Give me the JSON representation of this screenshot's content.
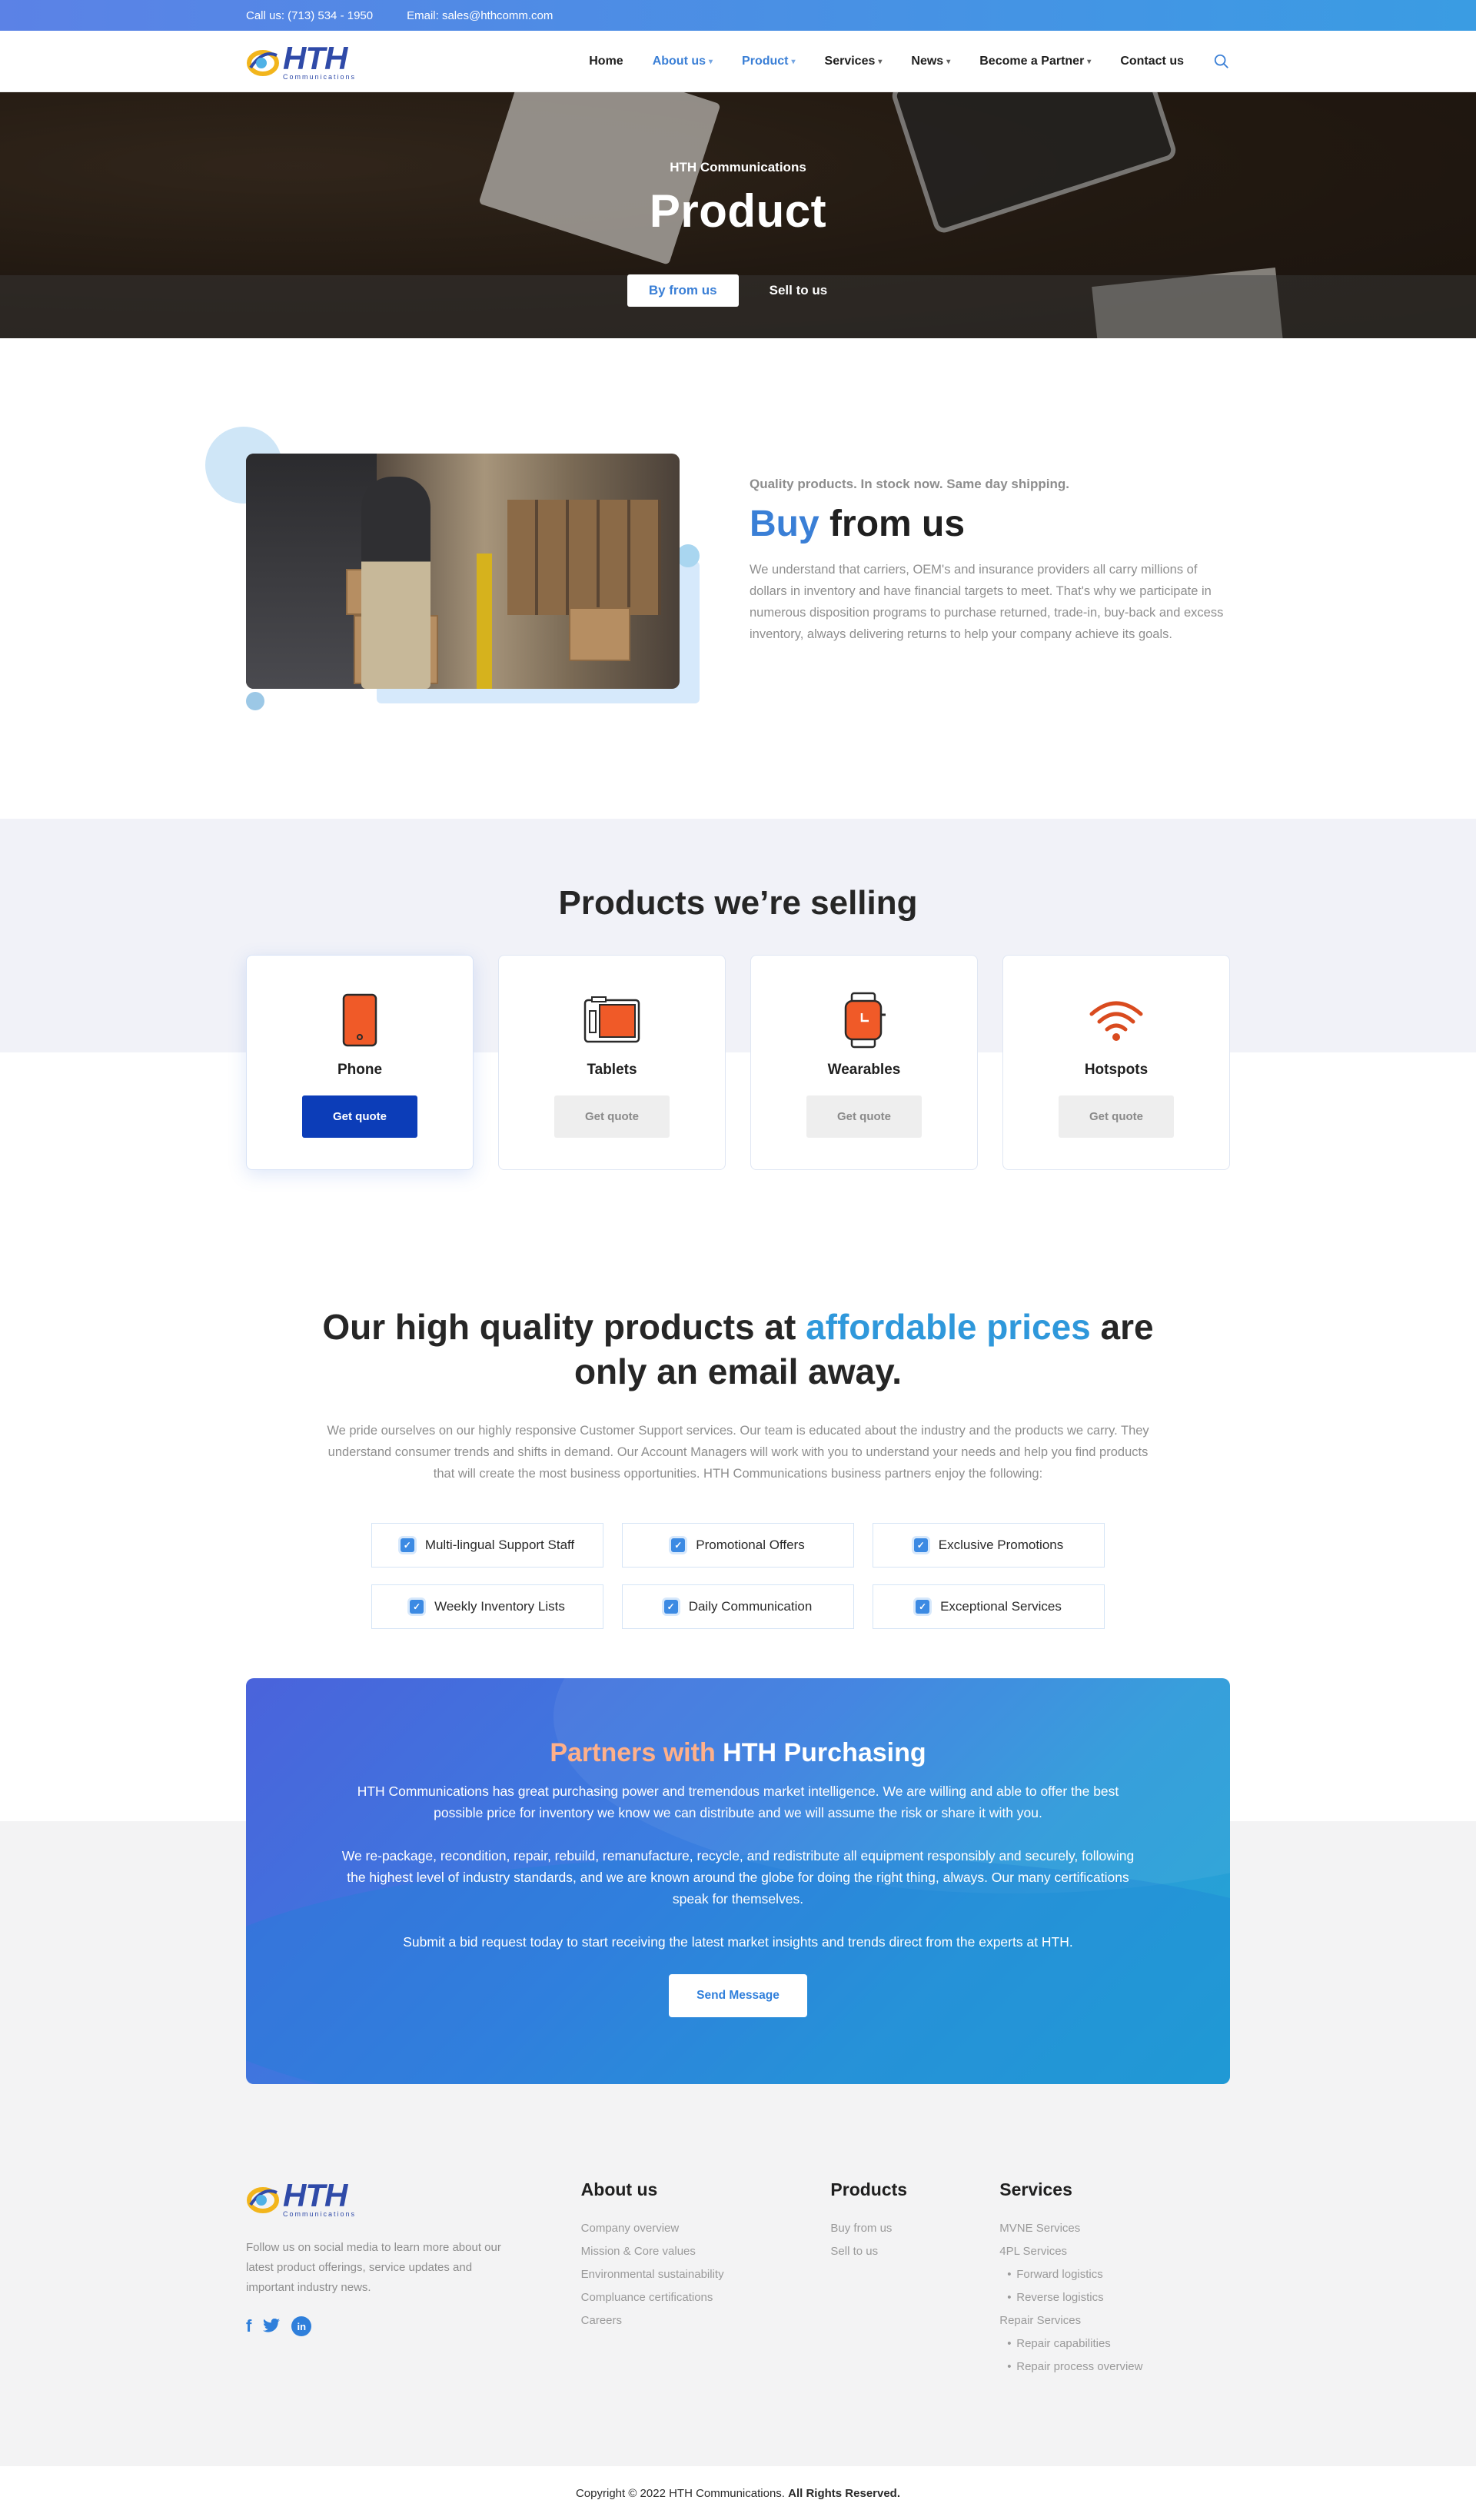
{
  "topbar": {
    "phone": "Call us: (713) 534 - 1950",
    "email": "Email: sales@hthcomm.com"
  },
  "brand": {
    "name": "HTH",
    "sub": "Communications"
  },
  "nav": [
    {
      "label": "Home",
      "active": false,
      "caret": false
    },
    {
      "label": "About us",
      "active": true,
      "caret": true
    },
    {
      "label": "Product",
      "active": true,
      "caret": true
    },
    {
      "label": "Services",
      "active": false,
      "caret": true
    },
    {
      "label": "News",
      "active": false,
      "caret": true
    },
    {
      "label": "Become a Partner",
      "active": false,
      "caret": true
    },
    {
      "label": "Contact us",
      "active": false,
      "caret": false
    }
  ],
  "hero": {
    "eyebrow": "HTH Communications",
    "title": "Product",
    "tab_buy": "By from us",
    "tab_sell": "Sell to us"
  },
  "buy": {
    "tag": "Quality products. In stock now. Same day shipping.",
    "title_hl": "Buy",
    "title_rest": " from us",
    "body": "We understand that carriers, OEM's and insurance providers all carry millions of dollars in inventory and have financial targets to meet. That's why we participate in numerous disposition programs to purchase returned, trade-in, buy-back and excess inventory, always delivering returns to help your company achieve its goals."
  },
  "selling": {
    "title": "Products we’re selling",
    "cards": [
      {
        "name": "Phone",
        "button": "Get quote"
      },
      {
        "name": "Tablets",
        "button": "Get quote"
      },
      {
        "name": "Wearables",
        "button": "Get quote"
      },
      {
        "name": "Hotspots",
        "button": "Get quote"
      }
    ]
  },
  "afford": {
    "title_a": "Our high quality products at ",
    "title_hl": "affordable prices",
    "title_b": " are only an email away.",
    "body": "We pride ourselves on our highly responsive Customer Support services. Our team is educated about the industry and the products we carry. They understand consumer trends and shifts in demand. Our Account Managers will work with you to understand your needs and help you find products that will create the most business opportunities. HTH Communications business partners enjoy the following:",
    "features": [
      "Multi-lingual Support Staff",
      "Promotional Offers",
      "Exclusive Promotions",
      "Weekly Inventory Lists",
      "Daily Communication",
      "Exceptional Services"
    ]
  },
  "partners": {
    "title_hl": "Partners with",
    "title_rest": " HTH Purchasing",
    "p1": "HTH Communications has great purchasing power and tremendous market intelligence. We are willing and able to offer the best possible price for inventory we know we can distribute and we will assume the risk or share it with you.",
    "p2": "We re-package, recondition, repair, rebuild, remanufacture, recycle, and redistribute all equipment responsibly and securely, following the highest level of industry standards, and we are known around the globe for doing the right thing, always. Our many certifications speak for themselves.",
    "p3": "Submit a bid request today to start receiving the latest market insights and trends direct from the experts at HTH.",
    "button": "Send Message"
  },
  "footer": {
    "about_text": "Follow us on social media to learn more about our latest product offerings, service updates and important industry news.",
    "col_about": {
      "title": "About us",
      "items": [
        "Company overview",
        "Mission & Core values",
        "Environmental sustainability",
        "Compluance certifications",
        "Careers"
      ]
    },
    "col_products": {
      "title": "Products",
      "items": [
        "Buy from us",
        "Sell to us"
      ]
    },
    "col_services": {
      "title": "Services",
      "items": [
        {
          "label": "MVNE Services",
          "sub": false
        },
        {
          "label": "4PL Services",
          "sub": false
        },
        {
          "label": "Forward logistics",
          "sub": true
        },
        {
          "label": "Reverse logistics",
          "sub": true
        },
        {
          "label": "Repair Services",
          "sub": false
        },
        {
          "label": "Repair capabilities",
          "sub": true
        },
        {
          "label": "Repair process overview",
          "sub": true
        }
      ]
    },
    "copyright": "Copyright © 2022 HTH Communications.",
    "rights": "All Rights Reserved."
  },
  "colors": {
    "primary": "#3a7fd6",
    "dark_button": "#0c3db8",
    "accent_orange": "#f05a28"
  }
}
